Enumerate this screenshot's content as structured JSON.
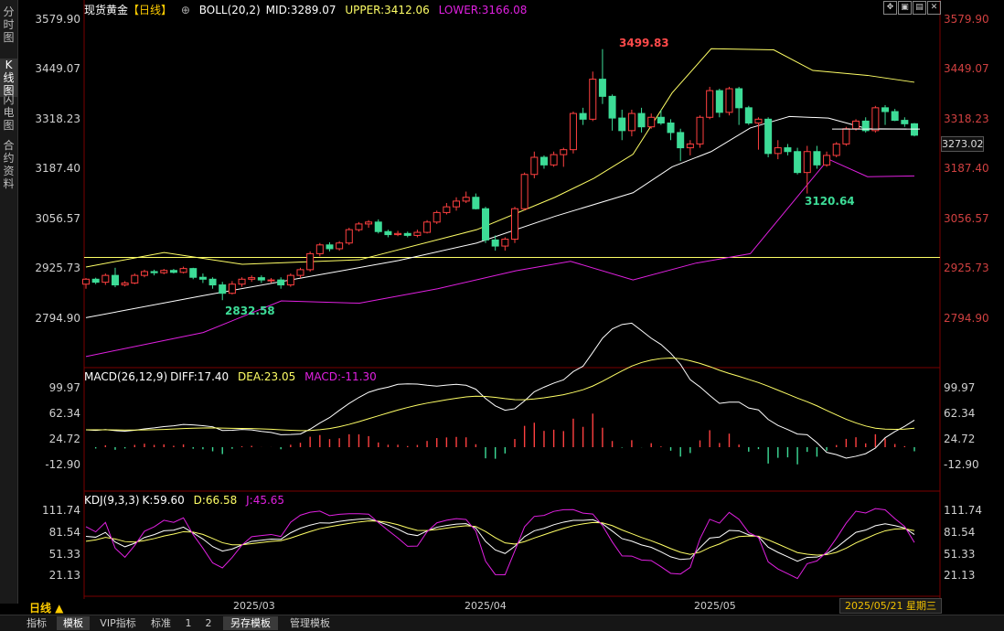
{
  "sidebar": {
    "tabs": [
      {
        "label": "分时图",
        "chars": [
          "分",
          "时",
          "图"
        ],
        "active": false
      },
      {
        "label": "K线图",
        "chars": [
          "K",
          "线",
          "图"
        ],
        "active": true
      },
      {
        "label": "闪电图",
        "chars": [
          "闪",
          "电",
          "图"
        ],
        "active": false
      },
      {
        "label": "合约资料",
        "chars": [
          "合",
          "约",
          "资",
          "料"
        ],
        "active": false
      }
    ]
  },
  "header": {
    "instrument": "现货黄金",
    "period": "【日线】",
    "boll_label": "BOLL(20,2)",
    "mid": "MID:3289.07",
    "upper": "UPPER:3412.06",
    "lower": "LOWER:3166.08"
  },
  "macd": {
    "label": "MACD(26,12,9)",
    "diff": "DIFF:17.40",
    "dea": "DEA:23.05",
    "macd": "MACD:-11.30",
    "ticks": [
      "99.97",
      "62.34",
      "24.72",
      "-12.90"
    ]
  },
  "kdj": {
    "label": "KDJ(9,3,3)",
    "k": "K:59.60",
    "d": "D:66.58",
    "j": "J:45.65",
    "ticks": [
      "111.74",
      "81.54",
      "51.33",
      "21.13"
    ]
  },
  "price_axis": [
    "3579.90",
    "3449.07",
    "3318.23",
    "3187.40",
    "3056.57",
    "2925.73",
    "2794.90"
  ],
  "last_price": "3273.02",
  "annotations": {
    "high": "3499.83",
    "low1": "2832.58",
    "low2": "3120.64"
  },
  "date_axis": [
    "2025/03",
    "2025/04",
    "2025/05"
  ],
  "period_label": "日线 ▲",
  "date_readout": "2025/05/21 星期三",
  "bottom_tabs": [
    "指标",
    "模板",
    "VIP指标",
    "标准",
    "1",
    "2",
    "另存模板",
    "管理模板"
  ],
  "colors": {
    "up": "#ff4040",
    "down": "#3ddc97",
    "mid": "#ffffff",
    "upper": "#ffff66",
    "lower": "#e020e0",
    "hline": "#ffff66"
  },
  "chart_data": [
    {
      "type": "candlestick",
      "title": "现货黄金 日线",
      "ylim": [
        2794.9,
        3579.9
      ],
      "candles": [
        [
          2882,
          2895,
          2870,
          2898
        ],
        [
          2895,
          2887,
          2882,
          2899
        ],
        [
          2887,
          2905,
          2880,
          2910
        ],
        [
          2905,
          2880,
          2874,
          2925
        ],
        [
          2880,
          2885,
          2876,
          2890
        ],
        [
          2885,
          2905,
          2882,
          2910
        ],
        [
          2905,
          2915,
          2900,
          2920
        ],
        [
          2915,
          2912,
          2905,
          2920
        ],
        [
          2912,
          2918,
          2908,
          2922
        ],
        [
          2918,
          2913,
          2910,
          2922
        ],
        [
          2913,
          2923,
          2910,
          2928
        ],
        [
          2923,
          2900,
          2895,
          2925
        ],
        [
          2900,
          2895,
          2885,
          2910
        ],
        [
          2895,
          2880,
          2870,
          2900
        ],
        [
          2880,
          2858,
          2840,
          2888
        ],
        [
          2858,
          2882,
          2855,
          2890
        ],
        [
          2882,
          2895,
          2875,
          2900
        ],
        [
          2895,
          2899,
          2888,
          2905
        ],
        [
          2899,
          2893,
          2885,
          2905
        ],
        [
          2893,
          2893,
          2885,
          2898
        ],
        [
          2893,
          2880,
          2870,
          2900
        ],
        [
          2880,
          2905,
          2875,
          2910
        ],
        [
          2905,
          2920,
          2898,
          2925
        ],
        [
          2920,
          2962,
          2915,
          2968
        ],
        [
          2962,
          2985,
          2955,
          2990
        ],
        [
          2985,
          2975,
          2968,
          2992
        ],
        [
          2975,
          2990,
          2970,
          2995
        ],
        [
          2990,
          3025,
          2985,
          3030
        ],
        [
          3025,
          3040,
          3020,
          3045
        ],
        [
          3040,
          3045,
          3030,
          3050
        ],
        [
          3045,
          3020,
          3015,
          3052
        ],
        [
          3020,
          3012,
          3005,
          3025
        ],
        [
          3012,
          3015,
          3008,
          3022
        ],
        [
          3015,
          3010,
          3005,
          3020
        ],
        [
          3010,
          3018,
          3005,
          3025
        ],
        [
          3018,
          3045,
          3015,
          3050
        ],
        [
          3045,
          3070,
          3040,
          3075
        ],
        [
          3070,
          3085,
          3065,
          3095
        ],
        [
          3085,
          3100,
          3075,
          3110
        ],
        [
          3100,
          3110,
          3095,
          3125
        ],
        [
          3110,
          3080,
          3078,
          3120
        ],
        [
          3080,
          2998,
          2990,
          3085
        ],
        [
          2998,
          2982,
          2970,
          3010
        ],
        [
          2982,
          3000,
          2970,
          3005
        ],
        [
          3000,
          3080,
          2990,
          3085
        ],
        [
          3080,
          3170,
          3075,
          3175
        ],
        [
          3170,
          3215,
          3160,
          3230
        ],
        [
          3215,
          3195,
          3185,
          3220
        ],
        [
          3195,
          3222,
          3190,
          3230
        ],
        [
          3222,
          3235,
          3190,
          3240
        ],
        [
          3235,
          3330,
          3225,
          3335
        ],
        [
          3330,
          3315,
          3300,
          3345
        ],
        [
          3315,
          3420,
          3310,
          3440
        ],
        [
          3420,
          3375,
          3355,
          3499
        ],
        [
          3375,
          3318,
          3285,
          3380
        ],
        [
          3318,
          3285,
          3260,
          3340
        ],
        [
          3285,
          3330,
          3270,
          3340
        ],
        [
          3330,
          3295,
          3280,
          3345
        ],
        [
          3295,
          3320,
          3290,
          3330
        ],
        [
          3320,
          3305,
          3300,
          3340
        ],
        [
          3305,
          3280,
          3260,
          3315
        ],
        [
          3280,
          3240,
          3205,
          3290
        ],
        [
          3240,
          3250,
          3220,
          3260
        ],
        [
          3250,
          3320,
          3240,
          3325
        ],
        [
          3320,
          3390,
          3315,
          3400
        ],
        [
          3390,
          3333,
          3320,
          3395
        ],
        [
          3333,
          3395,
          3325,
          3400
        ],
        [
          3395,
          3345,
          3300,
          3400
        ],
        [
          3345,
          3305,
          3300,
          3350
        ],
        [
          3305,
          3315,
          3235,
          3320
        ],
        [
          3315,
          3225,
          3215,
          3320
        ],
        [
          3225,
          3240,
          3210,
          3260
        ],
        [
          3240,
          3230,
          3220,
          3250
        ],
        [
          3230,
          3175,
          3170,
          3240
        ],
        [
          3175,
          3230,
          3120,
          3245
        ],
        [
          3230,
          3195,
          3185,
          3245
        ],
        [
          3195,
          3220,
          3190,
          3230
        ],
        [
          3220,
          3250,
          3215,
          3255
        ],
        [
          3250,
          3290,
          3245,
          3295
        ],
        [
          3290,
          3310,
          3285,
          3315
        ],
        [
          3310,
          3285,
          3280,
          3320
        ],
        [
          3285,
          3345,
          3280,
          3350
        ],
        [
          3345,
          3335,
          3300,
          3352
        ],
        [
          3335,
          3312,
          3310,
          3342
        ],
        [
          3312,
          3303,
          3295,
          3320
        ],
        [
          3303,
          3273,
          3270,
          3305
        ]
      ],
      "hline": 2952,
      "mid_band": [
        [
          0,
          2794
        ],
        [
          15,
          2852
        ],
        [
          30,
          2907
        ],
        [
          40,
          2944
        ],
        [
          50,
          2990
        ],
        [
          60,
          3060
        ],
        [
          70,
          3122
        ],
        [
          75,
          3190
        ],
        [
          80,
          3230
        ],
        [
          85,
          3292
        ],
        [
          90,
          3322
        ],
        [
          95,
          3318
        ],
        [
          100,
          3290
        ],
        [
          105,
          3289
        ]
      ],
      "upper_band": [
        [
          0,
          2927
        ],
        [
          10,
          2965
        ],
        [
          20,
          2934
        ],
        [
          35,
          2946
        ],
        [
          50,
          3025
        ],
        [
          60,
          3110
        ],
        [
          65,
          3160
        ],
        [
          70,
          3223
        ],
        [
          75,
          3384
        ],
        [
          80,
          3500
        ],
        [
          88,
          3497
        ],
        [
          93,
          3443
        ],
        [
          100,
          3430
        ],
        [
          106,
          3412
        ]
      ],
      "lower_band": [
        [
          0,
          2692
        ],
        [
          15,
          2755
        ],
        [
          25,
          2838
        ],
        [
          35,
          2832
        ],
        [
          45,
          2870
        ],
        [
          55,
          2917
        ],
        [
          62,
          2942
        ],
        [
          70,
          2893
        ],
        [
          78,
          2937
        ],
        [
          85,
          2962
        ],
        [
          95,
          3210
        ],
        [
          100,
          3164
        ],
        [
          106,
          3166
        ]
      ]
    }
  ]
}
